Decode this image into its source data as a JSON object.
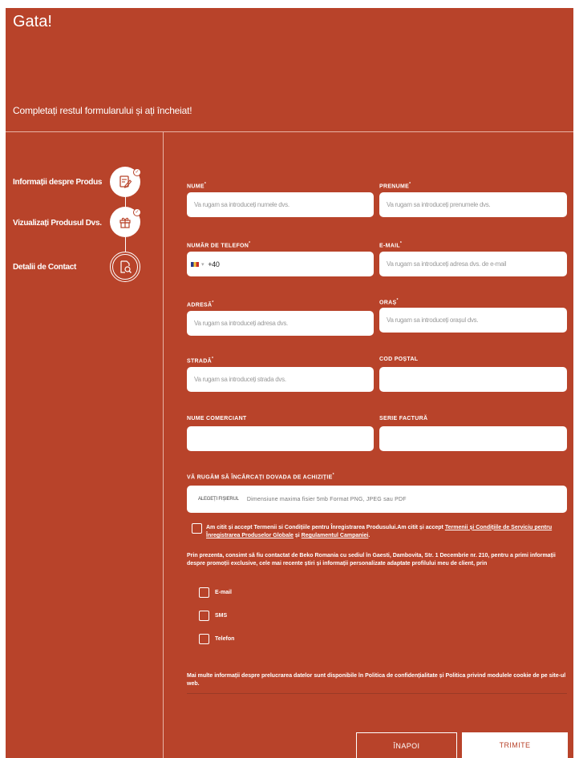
{
  "header": {
    "title": "Gata!",
    "subtitle": "Completați restul formularului și ați încheiat!"
  },
  "steps": [
    {
      "label": "Informații despre Produs",
      "icon": "edit-document-icon",
      "state": "done"
    },
    {
      "label": "Vizualizați Produsul Dvs.",
      "icon": "gift-icon",
      "state": "done"
    },
    {
      "label": "Detalii de Contact",
      "icon": "document-search-icon",
      "state": "active"
    }
  ],
  "form": {
    "nume": {
      "label": "NUME",
      "placeholder": "Va rugam sa introduceți numele dvs."
    },
    "prenume": {
      "label": "PRENUME",
      "placeholder": "Va rugam sa introduceți prenumele dvs."
    },
    "telefon": {
      "label": "NUMĂR DE TELEFON",
      "prefix": "+40"
    },
    "email": {
      "label": "E-MAIL",
      "placeholder": "Va rugam sa introduceți adresa dvs. de e-mail"
    },
    "adresa": {
      "label": "ADRESĂ",
      "placeholder": "Va rugam sa introduceți adresa dvs."
    },
    "oras": {
      "label": "ORAȘ",
      "placeholder": "Va rugam sa introduceți orașul dvs."
    },
    "strada": {
      "label": "STRADĂ",
      "placeholder": "Va rugam sa introduceți strada dvs."
    },
    "cod_postal": {
      "label": "COD POȘTAL",
      "placeholder": ""
    },
    "nume_comerciant": {
      "label": "NUME COMERCIANT",
      "placeholder": ""
    },
    "serie_factura": {
      "label": "SERIE FACTURĂ",
      "placeholder": ""
    },
    "upload": {
      "label": "VĂ RUGĂM SĂ ÎNCĂRCAȚI DOVADA DE ACHIZIȚIE",
      "button": "ALEGEȚI FIȘIERUL",
      "hint": "Dimensiune maxima fisier 5mb Format PNG, JPEG sau PDF"
    }
  },
  "consent": {
    "terms_prefix": "Am citit și accept Termenii si Condițiile pentru Înregistrarea Produsului.Am citit și accept ",
    "terms_link1": "Termenii și Condițiile de Serviciu pentru Înregistrarea Produselor Globale",
    "terms_and": " și ",
    "terms_link2": "Regulamentul Campaniei",
    "terms_end": ".",
    "contact_text": "Prin prezenta, consimt să fiu contactat de Beko Romania cu sediul în Gaesti, Dambovita, Str. 1 Decembrie nr. 210, pentru a primi informații despre promoții exclusive, cele mai recente știri și informații personalizate adaptate profilului meu de client, prin",
    "options": [
      "E-mail",
      "SMS",
      "Telefon"
    ],
    "privacy": "Mai multe informații despre prelucrarea datelor sunt disponibile în Politica de confidențialitate și Politica privind modulele cookie de pe site-ul web."
  },
  "actions": {
    "back": "ÎNAPOI",
    "submit": "TRIMITE"
  },
  "colors": {
    "brand": "#b8432a",
    "white": "#ffffff"
  }
}
